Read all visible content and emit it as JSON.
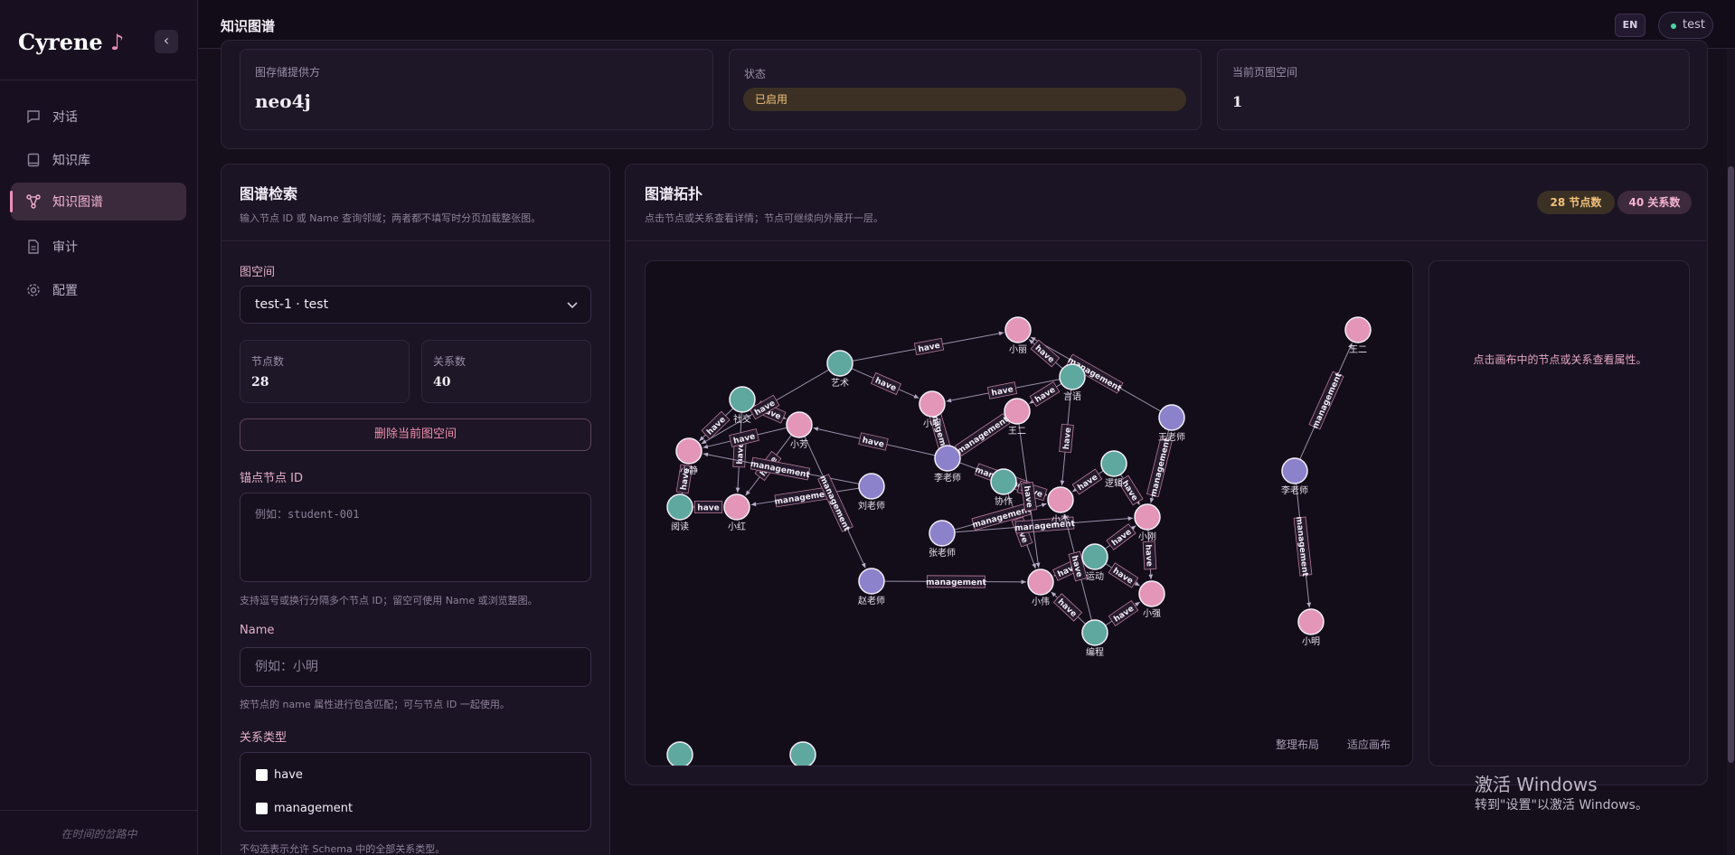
{
  "app": {
    "brand": "Cyrene",
    "brand_note": "♪",
    "tagline": "在时间的岔路中"
  },
  "sidebar": {
    "items": [
      {
        "label": "对话",
        "icon": "chat-icon",
        "active": false
      },
      {
        "label": "知识库",
        "icon": "book-icon",
        "active": false
      },
      {
        "label": "知识图谱",
        "icon": "graph-icon",
        "active": true
      },
      {
        "label": "审计",
        "icon": "document-icon",
        "active": false
      },
      {
        "label": "配置",
        "icon": "gear-icon",
        "active": false
      }
    ]
  },
  "header": {
    "title": "知识图谱",
    "lang": "EN",
    "user": "test"
  },
  "info": {
    "provider_label": "图存储提供方",
    "provider_value": "neo4j",
    "status_label": "状态",
    "status_value": "已启用",
    "space_label": "当前页图空间",
    "space_value": "1"
  },
  "search": {
    "title": "图谱检索",
    "subtitle": "输入节点 ID 或 Name 查询邻域；两者都不填写时分页加载整张图。",
    "space_label": "图空间",
    "space_selected": "test-1 · test",
    "node_count_label": "节点数",
    "node_count": "28",
    "edge_count_label": "关系数",
    "edge_count": "40",
    "delete_button": "删除当前图空间",
    "anchor_label": "锚点节点 ID",
    "anchor_placeholder": "例如：student-001",
    "anchor_help": "支持逗号或换行分隔多个节点 ID；留空可使用 Name 或浏览整图。",
    "name_label": "Name",
    "name_placeholder": "例如：小明",
    "name_help": "按节点的 name 属性进行包含匹配；可与节点 ID 一起使用。",
    "rel_label": "关系类型",
    "rel_options": [
      "have",
      "management"
    ],
    "rel_help": "不勾选表示允许 Schema 中的全部关系类型。"
  },
  "topology": {
    "title": "图谱拓扑",
    "subtitle": "点击节点或关系查看详情；节点可继续向外展开一层。",
    "node_badge": "28 节点数",
    "edge_badge": "40 关系数",
    "layout_button": "整理布局",
    "fit_button": "适应画布",
    "props_hint": "点击画布中的节点或关系查看属性。"
  },
  "graph": {
    "colors": {
      "pink": "#e396b8",
      "teal": "#5ea8a0",
      "purple": "#8c82cc"
    },
    "nodes": [
      {
        "id": "xiaoli",
        "label": "小丽",
        "color": "pink"
      },
      {
        "id": "yishu",
        "label": "艺术",
        "color": "teal"
      },
      {
        "id": "shejiao",
        "label": "社交",
        "color": "teal"
      },
      {
        "id": "xiaofang",
        "label": "小芳",
        "color": "pink"
      },
      {
        "id": "xiaoming",
        "label": "小明",
        "color": "pink"
      },
      {
        "id": "yuyan",
        "label": "言语",
        "color": "teal"
      },
      {
        "id": "wanger",
        "label": "王二",
        "color": "pink"
      },
      {
        "id": "wanglaoshi",
        "label": "王老师",
        "color": "purple"
      },
      {
        "id": "xiaojing",
        "label": "小静",
        "color": "pink"
      },
      {
        "id": "lilaoshi",
        "label": "李老师",
        "color": "purple"
      },
      {
        "id": "luoji",
        "label": "逻辑",
        "color": "teal"
      },
      {
        "id": "liulaoshi",
        "label": "刘老师",
        "color": "purple"
      },
      {
        "id": "xiezuo",
        "label": "协作",
        "color": "teal"
      },
      {
        "id": "yuedu",
        "label": "阅读",
        "color": "teal"
      },
      {
        "id": "xiaohong",
        "label": "小红",
        "color": "pink"
      },
      {
        "id": "xiaojie",
        "label": "小杰",
        "color": "pink"
      },
      {
        "id": "xiaogang",
        "label": "小刚",
        "color": "pink"
      },
      {
        "id": "zhanglaoshi",
        "label": "张老师",
        "color": "purple"
      },
      {
        "id": "yundong",
        "label": "运动",
        "color": "teal"
      },
      {
        "id": "zhaolaoshi",
        "label": "赵老师",
        "color": "purple"
      },
      {
        "id": "xiaowei",
        "label": "小伟",
        "color": "pink"
      },
      {
        "id": "xiaoqiang",
        "label": "小强",
        "color": "pink"
      },
      {
        "id": "biancheng",
        "label": "编程",
        "color": "teal"
      },
      {
        "id": "wanger2",
        "label": "王二",
        "color": "pink"
      },
      {
        "id": "lilaoshi2",
        "label": "李老师",
        "color": "purple"
      },
      {
        "id": "xiaoming2",
        "label": "小明",
        "color": "pink"
      },
      {
        "id": "extra1",
        "label": "",
        "color": "teal"
      },
      {
        "id": "extra2",
        "label": "",
        "color": "teal"
      }
    ],
    "edges": [
      {
        "s": "yishu",
        "t": "xiaoli",
        "label": "have"
      },
      {
        "s": "wanglaoshi",
        "t": "xiaoli",
        "label": "management"
      },
      {
        "s": "yuyan",
        "t": "xiaoli",
        "label": "have"
      },
      {
        "s": "yuyan",
        "t": "xiaoming",
        "label": "have"
      },
      {
        "s": "yuyan",
        "t": "wanger",
        "label": "have"
      },
      {
        "s": "yishu",
        "t": "xiaoming",
        "label": "have"
      },
      {
        "s": "shejiao",
        "t": "xiaojing",
        "label": "have"
      },
      {
        "s": "shejiao",
        "t": "xiaofang",
        "label": "have"
      },
      {
        "s": "shejiao",
        "t": "xiaohong",
        "label": "have"
      },
      {
        "s": "yishu",
        "t": "xiaojing",
        "label": "have"
      },
      {
        "s": "xiaofang",
        "t": "xiaojing",
        "label": "have"
      },
      {
        "s": "xiaofang",
        "t": "xiaohong",
        "label": "have"
      },
      {
        "s": "lilaoshi",
        "t": "xiaofang",
        "label": "have"
      },
      {
        "s": "lilaoshi",
        "t": "wanger",
        "label": "management"
      },
      {
        "s": "lilaoshi",
        "t": "xiaoming",
        "label": "management"
      },
      {
        "s": "yuedu",
        "t": "xiaojing",
        "label": "have"
      },
      {
        "s": "yuedu",
        "t": "xiaohong",
        "label": "have"
      },
      {
        "s": "liulaoshi",
        "t": "xiaojing",
        "label": "management"
      },
      {
        "s": "liulaoshi",
        "t": "xiaohong",
        "label": "management"
      },
      {
        "s": "xiaofang",
        "t": "zhaolaoshi",
        "label": "management"
      },
      {
        "s": "lilaoshi",
        "t": "xiaojie",
        "label": "management"
      },
      {
        "s": "xiezuo",
        "t": "xiaojie",
        "label": "have"
      },
      {
        "s": "xiezuo",
        "t": "xiaowei",
        "label": "have"
      },
      {
        "s": "luoji",
        "t": "xiaojie",
        "label": "have"
      },
      {
        "s": "luoji",
        "t": "xiaogang",
        "label": "have"
      },
      {
        "s": "wanglaoshi",
        "t": "xiaogang",
        "label": "management"
      },
      {
        "s": "zhanglaoshi",
        "t": "xiaogang",
        "label": "management"
      },
      {
        "s": "zhanglaoshi",
        "t": "xiaojie",
        "label": "management"
      },
      {
        "s": "yundong",
        "t": "xiaowei",
        "label": "have"
      },
      {
        "s": "yundong",
        "t": "xiaoqiang",
        "label": "have"
      },
      {
        "s": "yundong",
        "t": "xiaogang",
        "label": "have"
      },
      {
        "s": "biancheng",
        "t": "xiaowei",
        "label": "have"
      },
      {
        "s": "biancheng",
        "t": "xiaoqiang",
        "label": "have"
      },
      {
        "s": "biancheng",
        "t": "xiaojie",
        "label": "have"
      },
      {
        "s": "zhaolaoshi",
        "t": "xiaowei",
        "label": "management"
      },
      {
        "s": "wanger",
        "t": "xiaowei",
        "label": "have"
      },
      {
        "s": "xiaogang",
        "t": "xiaoqiang",
        "label": "have"
      },
      {
        "s": "yuyan",
        "t": "xiaojie",
        "label": "have"
      },
      {
        "s": "lilaoshi2",
        "t": "wanger2",
        "label": "management"
      },
      {
        "s": "lilaoshi2",
        "t": "xiaoming2",
        "label": "management"
      }
    ]
  },
  "os_watermark": {
    "title": "激活 Windows",
    "body": "转到\"设置\"以激活 Windows。"
  }
}
